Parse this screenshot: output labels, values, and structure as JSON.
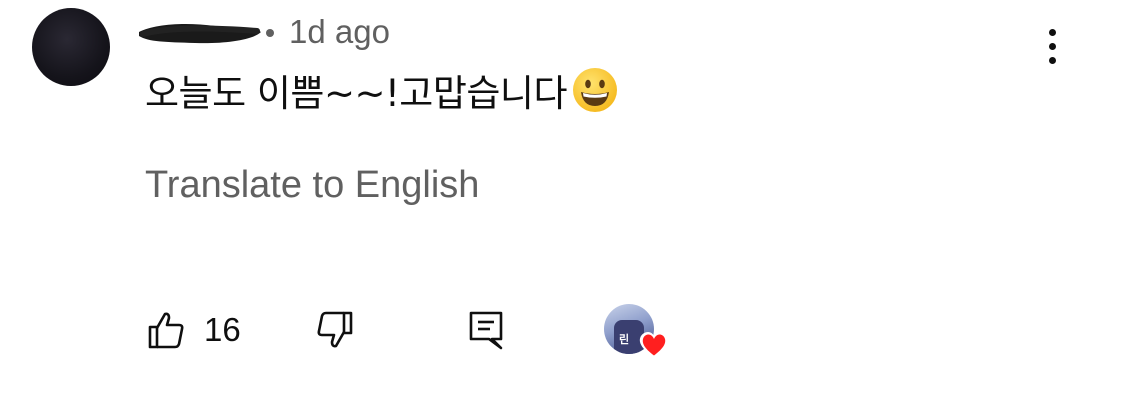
{
  "comment": {
    "timestamp": "1d ago",
    "text": "오늘도 이쁨~~!고맙습니다",
    "translate_label": "Translate to English"
  },
  "actions": {
    "like_count": "16"
  },
  "creator": {
    "jersey_text": "린"
  },
  "colors": {
    "text_primary": "#0f0f0f",
    "text_secondary": "#606060",
    "heart": "#ff1f1f"
  },
  "icons": {
    "like": "thumbs-up-icon",
    "dislike": "thumbs-down-icon",
    "reply": "comment-icon",
    "more": "more-vertical-icon",
    "heart": "heart-icon",
    "emoji": "grinning-face-emoji"
  }
}
